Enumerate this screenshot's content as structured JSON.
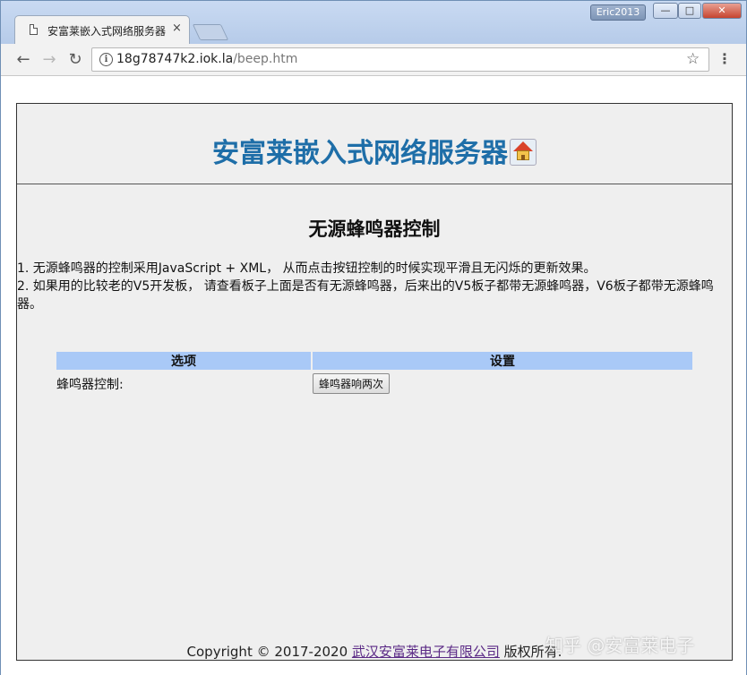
{
  "window": {
    "user_badge": "Eric2013",
    "min_label": "—",
    "max_label": "□",
    "close_label": "✕"
  },
  "tab": {
    "title": "安富莱嵌入式网络服务器",
    "close": "×"
  },
  "toolbar": {
    "back": "←",
    "forward": "→",
    "reload": "↻",
    "info": "i",
    "url_host": "18g78747k2.iok.la",
    "url_path": "/beep.htm",
    "star": "☆",
    "menu": "⋮"
  },
  "page": {
    "site_title": "安富莱嵌入式网络服务器",
    "section_title": "无源蜂鸣器控制",
    "desc_line1": "1. 无源蜂鸣器的控制采用JavaScript + XML， 从而点击按钮控制的时候实现平滑且无闪烁的更新效果。",
    "desc_line2": "2. 如果用的比较老的V5开发板， 请查看板子上面是否有无源蜂鸣器，后来出的V5板子都带无源蜂鸣器，V6板子都带无源蜂鸣器。",
    "table": {
      "col_option": "选项",
      "col_setting": "设置",
      "row_label": "蜂鸣器控制:",
      "button_label": "蜂鸣器响两次"
    },
    "footer_prefix": "Copyright © 2017-2020 ",
    "footer_link": "武汉安富莱电子有限公司",
    "footer_suffix": " 版权所有."
  },
  "watermark": "知乎 @安富莱电子",
  "colors": {
    "title_blue": "#1e6ea8",
    "table_header": "#a9c9f7",
    "link_purple": "#5b2a86"
  }
}
